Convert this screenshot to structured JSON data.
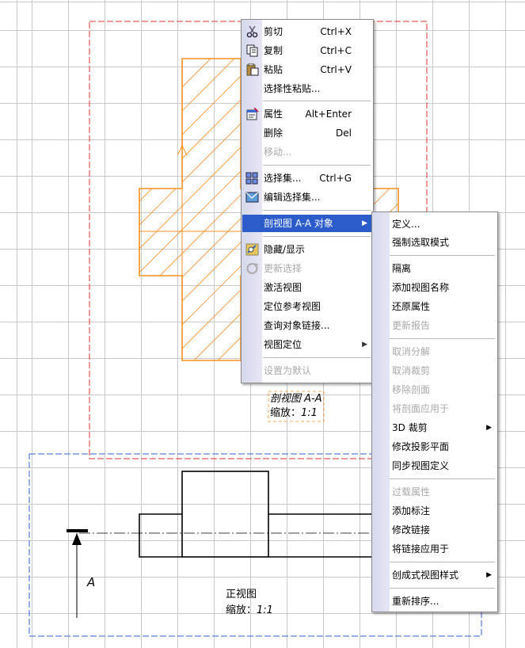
{
  "context_menu": {
    "items": [
      {
        "label": "剪切",
        "shortcut": "Ctrl+X",
        "icon": "scissors-icon",
        "enabled": true
      },
      {
        "label": "复制",
        "shortcut": "Ctrl+C",
        "icon": "copy-icon",
        "enabled": true
      },
      {
        "label": "粘贴",
        "shortcut": "Ctrl+V",
        "icon": "paste-icon",
        "enabled": true
      },
      {
        "label": "选择性粘贴...",
        "shortcut": "",
        "enabled": true
      },
      {
        "label": "属性",
        "shortcut": "Alt+Enter",
        "icon": "properties-icon",
        "enabled": true
      },
      {
        "label": "删除",
        "shortcut": "Del",
        "enabled": true
      },
      {
        "label": "移动...",
        "shortcut": "",
        "enabled": false
      },
      {
        "label": "选择集...",
        "shortcut": "Ctrl+G",
        "icon": "selection-set-icon",
        "enabled": true
      },
      {
        "label": "编辑选择集...",
        "shortcut": "",
        "icon": "edit-selection-set-icon",
        "enabled": true
      },
      {
        "label": "剖视图 A-A 对象",
        "shortcut": "",
        "submenu": true,
        "highlighted": true,
        "enabled": true
      },
      {
        "label": "隐藏/显示",
        "shortcut": "",
        "icon": "hide-show-icon",
        "enabled": true
      },
      {
        "label": "更新选择",
        "shortcut": "",
        "icon": "update-icon",
        "enabled": false
      },
      {
        "label": "激活视图",
        "shortcut": "",
        "enabled": true
      },
      {
        "label": "定位参考视图",
        "shortcut": "",
        "enabled": true
      },
      {
        "label": "查询对象链接...",
        "shortcut": "",
        "enabled": true
      },
      {
        "label": "视图定位",
        "shortcut": "",
        "submenu": true,
        "enabled": true
      },
      {
        "label": "设置为默认",
        "shortcut": "",
        "enabled": false
      }
    ]
  },
  "submenu": {
    "items": [
      {
        "label": "定义...",
        "enabled": true
      },
      {
        "label": "强制选取模式",
        "enabled": true
      },
      {
        "label": "隔离",
        "enabled": true
      },
      {
        "label": "添加视图名称",
        "enabled": true
      },
      {
        "label": "还原属性",
        "enabled": true
      },
      {
        "label": "更新报告",
        "enabled": false
      },
      {
        "label": "取消分解",
        "enabled": false
      },
      {
        "label": "取消裁剪",
        "enabled": false
      },
      {
        "label": "移除剖面",
        "enabled": false
      },
      {
        "label": "将剖面应用于",
        "enabled": false
      },
      {
        "label": "3D 裁剪",
        "enabled": true,
        "submenu": true
      },
      {
        "label": "修改投影平面",
        "enabled": true
      },
      {
        "label": "同步视图定义",
        "enabled": true
      },
      {
        "label": "过载属性",
        "enabled": false,
        "annotated": true
      },
      {
        "label": "添加标注",
        "enabled": true
      },
      {
        "label": "修改链接",
        "enabled": true
      },
      {
        "label": "将链接应用于",
        "enabled": true
      },
      {
        "label": "创成式视图样式",
        "enabled": true,
        "submenu": true
      },
      {
        "label": "重新排序...",
        "enabled": true
      }
    ]
  },
  "section_view": {
    "name": "剖视图 A-A",
    "scale_label": "缩放：",
    "scale_value": "1:1"
  },
  "front_view": {
    "name": "正视图",
    "scale_label": "缩放：",
    "scale_value": "1:1"
  },
  "section_arrow_label": "A",
  "colors": {
    "section_frame": "#e03030",
    "front_frame": "#3060d0",
    "section_geometry": "#f59020",
    "highlight": "#2b5cc9",
    "annotation": "#e02020"
  }
}
